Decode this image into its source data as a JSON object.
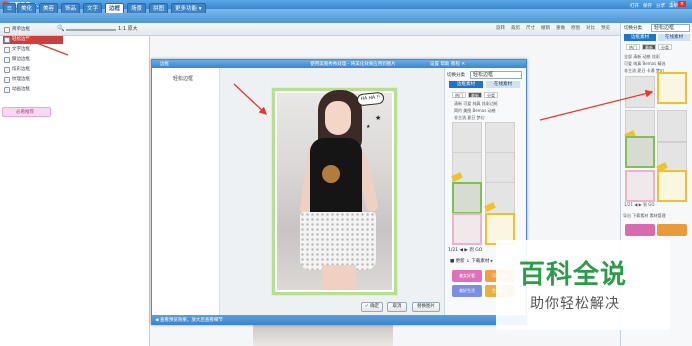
{
  "app": {
    "title": "美图秀秀 4.0.1",
    "window_controls": [
      "-",
      "□",
      "×"
    ]
  },
  "menu": {
    "tabs": [
      "美化",
      "美容",
      "饰品",
      "文字",
      "边框",
      "场景",
      "拼图",
      "更多功能 ▾"
    ],
    "active_index": 4,
    "right": [
      "打开",
      "保存",
      "分享",
      "菜单"
    ]
  },
  "toolbar": {
    "zoom_label": "1:1 原大",
    "right_items": [
      "旋转",
      "裁剪",
      "尺寸",
      "撤销",
      "重做",
      "原图",
      "对比",
      "预览"
    ]
  },
  "left_panel": {
    "items": [
      {
        "label": "简单边框",
        "selected": false
      },
      {
        "label": "轻松边框",
        "selected": true
      },
      {
        "label": "文字边框",
        "selected": false
      },
      {
        "label": "撕边边框",
        "selected": false
      },
      {
        "label": "炫彩边框",
        "selected": false
      },
      {
        "label": "纹理边框",
        "selected": false
      },
      {
        "label": "动画边框",
        "selected": false
      }
    ],
    "recommend": "必看推荐"
  },
  "right_panel": {
    "label": "切换分类",
    "category": "轻松边框",
    "tabs": [
      "边框素材",
      "在线素材"
    ],
    "chips": [
      "热门",
      "最新",
      "分类"
    ],
    "row1": "全部  清新  动感  炫彩",
    "row2": "可爱  纯真  Bemas  精选",
    "row3": "非主流  夏日  卡通  梦幻",
    "pager": "1/21  ◀  ▶  到  GO",
    "bottom": [
      "导出",
      "下载素材",
      "素材管理"
    ]
  },
  "dialog": {
    "app_name": "边框",
    "title": "使用美图秀秀处理 - 将美化效果应用到图片",
    "right_items": [
      "设置",
      "帮助",
      "教程"
    ],
    "left_label": "轻松边框",
    "panel": {
      "label": "切换分类",
      "category": "轻松边框",
      "tabs": [
        "边框素材",
        "在线素材"
      ],
      "chips": [
        "热门",
        "最新",
        "分类"
      ],
      "row1": "清新  可爱  纯真  炫彩边框",
      "row2": "简约  美图  Bemas  动感",
      "row3": "非主流  夏日  梦幻",
      "pager": "1/21  ◀  ▶  到  GO",
      "more": "■ 更新  ↓ 下载素材  ▸"
    },
    "photo_caption": "HA HA !!",
    "stickers": [
      "美女好看",
      "可爱嗨呦",
      "美好生活",
      "生活快乐"
    ],
    "buttons": {
      "ok": "✓ 确定",
      "cancel": "取消",
      "replace": "替换图片"
    },
    "status": "◀ 查看预览效果，放大后查看细节"
  },
  "watermark": {
    "main": "百科全说",
    "sub": "助你轻松解决"
  },
  "colors": {
    "accent": "#3a86cf",
    "selected_item": "#c93f3f",
    "frame_green": "#b8df8f",
    "arrow": "#e23b2b",
    "watermark": "#2c9b4a"
  }
}
